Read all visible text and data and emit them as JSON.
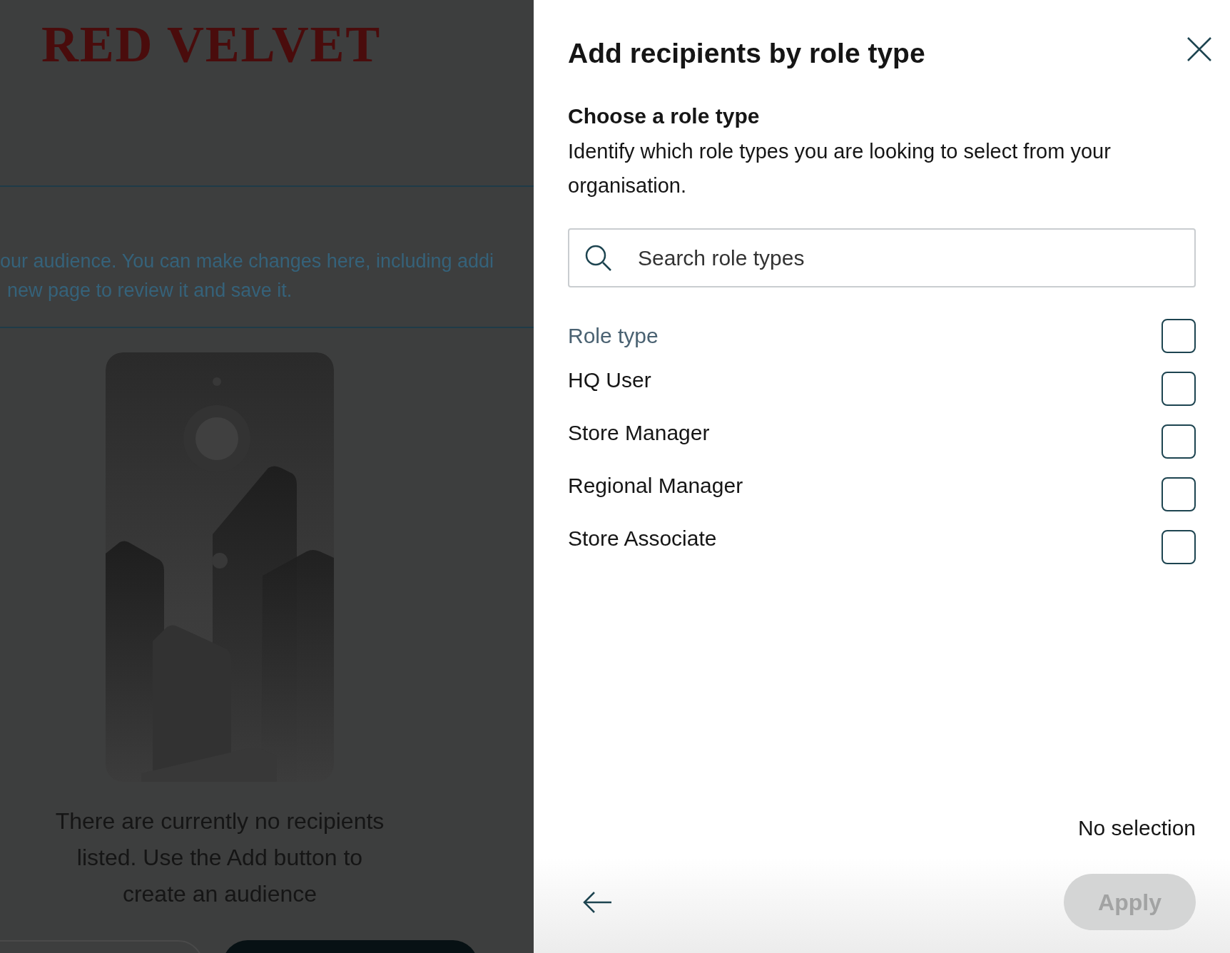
{
  "background": {
    "logo": "RED VELVET",
    "intro_lines": [
      "our audience. You can make changes here, including addi",
      "new page to review it and save it."
    ],
    "empty_message": "There are currently no recipients listed. Use the Add button to create an audience"
  },
  "panel": {
    "title": "Add recipients by role type",
    "section_title": "Choose a role type",
    "description": "Identify which role types you are looking to select from your organisation.",
    "search": {
      "placeholder": "Search role types"
    },
    "roles": [
      {
        "kind": "header",
        "label": "Role type",
        "checked": false
      },
      {
        "kind": "option",
        "label": "HQ User",
        "checked": false
      },
      {
        "kind": "option",
        "label": "Store Manager",
        "checked": false
      },
      {
        "kind": "option",
        "label": "Regional Manager",
        "checked": false
      },
      {
        "kind": "option",
        "label": "Store Associate",
        "checked": false
      }
    ],
    "selection_status": "No selection",
    "apply_button": {
      "label": "Apply",
      "disabled": true
    }
  }
}
